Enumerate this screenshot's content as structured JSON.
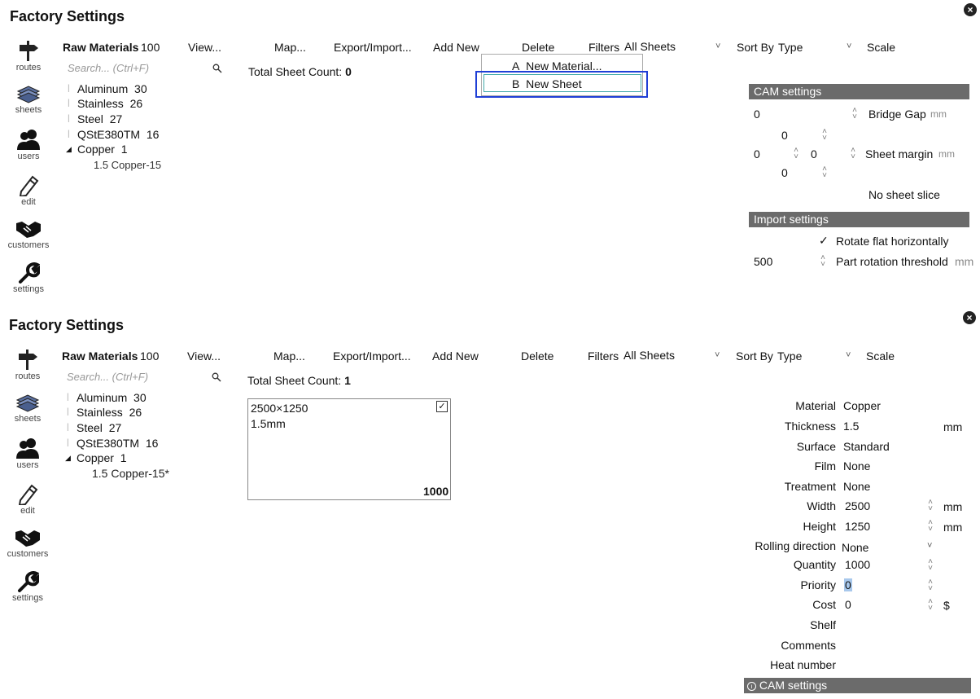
{
  "top": {
    "title": "Factory Settings",
    "toolbar": {
      "raw_materials": "Raw Materials",
      "raw_count": "100",
      "view": "View...",
      "map": "Map...",
      "export_import": "Export/Import...",
      "add_new": "Add New",
      "delete": "Delete",
      "filters_label": "Filters",
      "filters_value": "All Sheets",
      "sort_label": "Sort By",
      "sort_value": "Type",
      "scale": "Scale"
    },
    "search_placeholder": "Search... (Ctrl+F)",
    "tree": [
      {
        "name": "Aluminum",
        "count": "30"
      },
      {
        "name": "Stainless",
        "count": "26"
      },
      {
        "name": "Steel",
        "count": "27"
      },
      {
        "name": "QStE380TM",
        "count": "16"
      },
      {
        "name": "Copper",
        "count": "1"
      }
    ],
    "tree_child": "1.5 Copper-15",
    "total_label": "Total Sheet Count:",
    "total_value": "0",
    "add_menu": {
      "item_a_key": "A",
      "item_a": "New Material...",
      "item_b_key": "B",
      "item_b": "New Sheet"
    },
    "cam": {
      "header": "CAM settings",
      "bridge_value": "0",
      "bridge_label": "Bridge Gap",
      "bridge_unit": "mm",
      "margin_top": "0",
      "margin_left": "0",
      "margin_right": "0",
      "margin_bottom": "0",
      "margin_label": "Sheet margin",
      "margin_unit": "mm",
      "no_slice": "No sheet slice"
    },
    "import": {
      "header": "Import settings",
      "rotate_check": "✓",
      "rotate_label": "Rotate flat horizontally",
      "threshold_value": "500",
      "threshold_label": "Part rotation threshold",
      "threshold_unit": "mm"
    }
  },
  "nav": [
    {
      "label": "routes",
      "icon": "signpost-icon"
    },
    {
      "label": "sheets",
      "icon": "sheets-stack-icon"
    },
    {
      "label": "users",
      "icon": "users-icon"
    },
    {
      "label": "edit",
      "icon": "pencil-icon"
    },
    {
      "label": "customers",
      "icon": "handshake-icon"
    },
    {
      "label": "settings",
      "icon": "wrench-icon"
    }
  ],
  "bottom": {
    "title": "Factory Settings",
    "tree_child": "1.5 Copper-15*",
    "total_value": "1",
    "sheet_card": {
      "size": "2500×1250",
      "thickness": "1.5mm",
      "quantity": "1000",
      "checked": "✓"
    },
    "props": {
      "material_label": "Material",
      "material_value": "Copper",
      "thickness_label": "Thickness",
      "thickness_value": "1.5",
      "thickness_unit": "mm",
      "surface_label": "Surface",
      "surface_value": "Standard",
      "film_label": "Film",
      "film_value": "None",
      "treatment_label": "Treatment",
      "treatment_value": "None",
      "width_label": "Width",
      "width_value": "2500",
      "width_unit": "mm",
      "height_label": "Height",
      "height_value": "1250",
      "height_unit": "mm",
      "rolling_label": "Rolling direction",
      "rolling_value": "None",
      "quantity_label": "Quantity",
      "quantity_value": "1000",
      "priority_label": "Priority",
      "priority_value": "0",
      "cost_label": "Cost",
      "cost_value": "0",
      "cost_unit": "$",
      "shelf_label": "Shelf",
      "comments_label": "Comments",
      "heat_label": "Heat number",
      "cam_header": "CAM settings"
    }
  }
}
